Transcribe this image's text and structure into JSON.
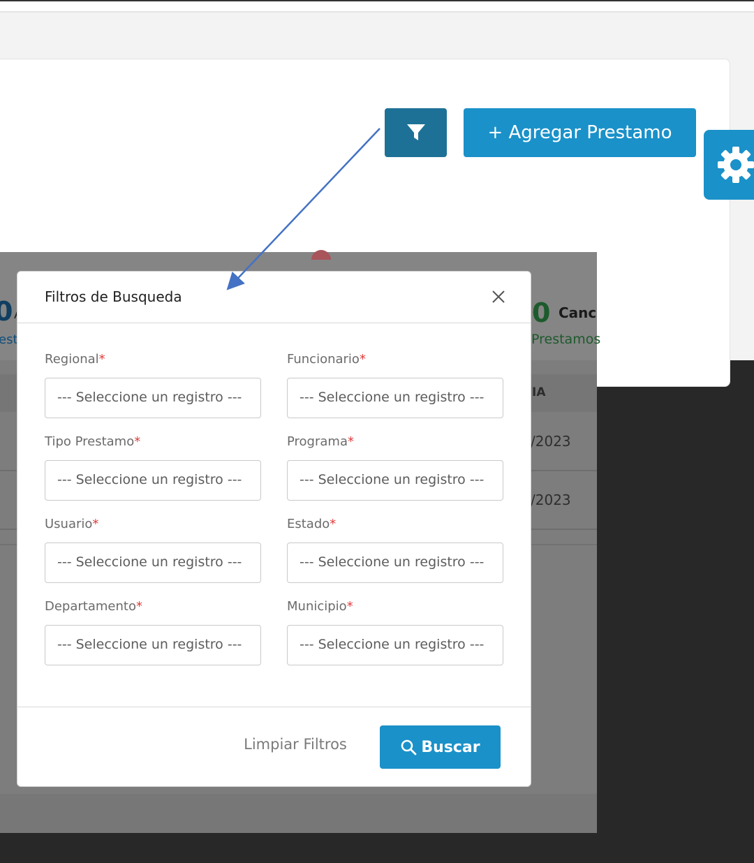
{
  "toolbar": {
    "filter_icon": "filter-icon",
    "add_label": "+ Agregar Prestamo",
    "settings_icon": "gear-icon"
  },
  "background": {
    "stat_left_number": "0",
    "stat_left_letter": "A",
    "stat_left_sub": "est",
    "stat_right_number": "0",
    "stat_right_label": "Canc",
    "stat_right_sub": "Prestamos",
    "table_header_partial": "IA",
    "row1_date": "/2023",
    "row2_date": "/2023"
  },
  "modal": {
    "title": "Filtros de Busqueda",
    "close_icon": "close-icon",
    "fields": [
      {
        "label": "Regional",
        "required": "*",
        "placeholder": "--- Seleccione un registro ---"
      },
      {
        "label": "Funcionario",
        "required": "*",
        "placeholder": "--- Seleccione un registro ---"
      },
      {
        "label": "Tipo Prestamo",
        "required": "*",
        "placeholder": "--- Seleccione un registro ---"
      },
      {
        "label": "Programa",
        "required": "*",
        "placeholder": "--- Seleccione un registro ---"
      },
      {
        "label": "Usuario",
        "required": "*",
        "placeholder": "--- Seleccione un registro ---"
      },
      {
        "label": "Estado",
        "required": "*",
        "placeholder": "--- Seleccione un registro ---"
      },
      {
        "label": "Departamento",
        "required": "*",
        "placeholder": "--- Seleccione un registro ---"
      },
      {
        "label": "Municipio",
        "required": "*",
        "placeholder": "--- Seleccione un registro ---"
      }
    ],
    "clear_label": "Limpiar Filtros",
    "search_label": "Buscar",
    "search_icon": "search-icon"
  },
  "colors": {
    "primary": "#1a91c9",
    "filter_button": "#1e7196",
    "annotation_arrow": "#4472c4",
    "required": "#e33a3a",
    "stat_blue": "#1a6fb0",
    "stat_green": "#2f8f46"
  }
}
